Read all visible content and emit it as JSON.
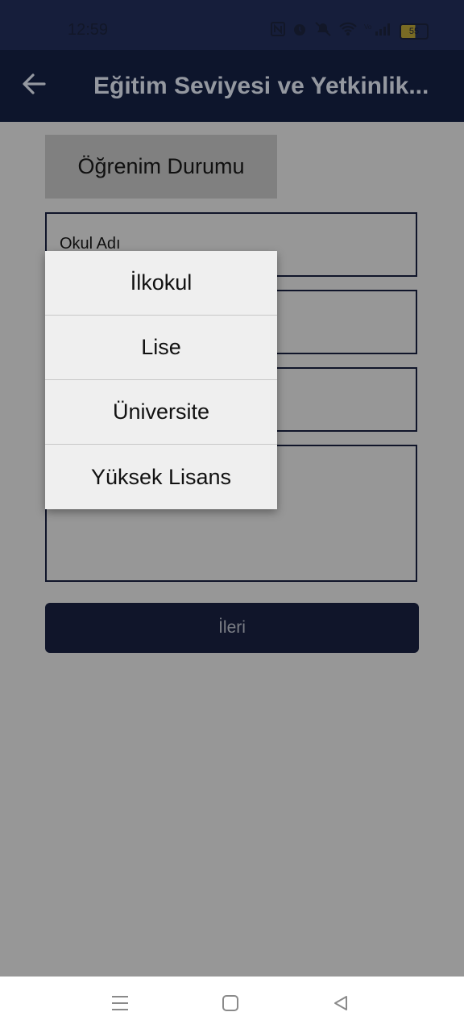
{
  "status_bar": {
    "time": "12:59",
    "battery_level": "55",
    "icons": [
      "nfc-icon",
      "alarm-icon",
      "mute-icon",
      "wifi-icon",
      "signal-icon",
      "battery-icon"
    ]
  },
  "app_bar": {
    "back_icon": "arrow-left-icon",
    "title": "Eğitim Seviyesi ve Yetkinlik..."
  },
  "form": {
    "section_header": "Öğrenim Durumu",
    "fields": [
      {
        "label": "Okul Adı"
      },
      {
        "label": ""
      },
      {
        "label": ""
      },
      {
        "label": ""
      }
    ],
    "next_button": "İleri"
  },
  "dropdown": {
    "options": [
      "İlkokul",
      "Lise",
      "Üniversite",
      "Yüksek Lisans"
    ]
  },
  "nav_bar": {
    "icons": [
      "menu-icon",
      "home-icon",
      "back-icon"
    ]
  },
  "colors": {
    "primary": "#1a2344",
    "scrim": "#9a9a9a",
    "popup_bg": "#efefef"
  }
}
